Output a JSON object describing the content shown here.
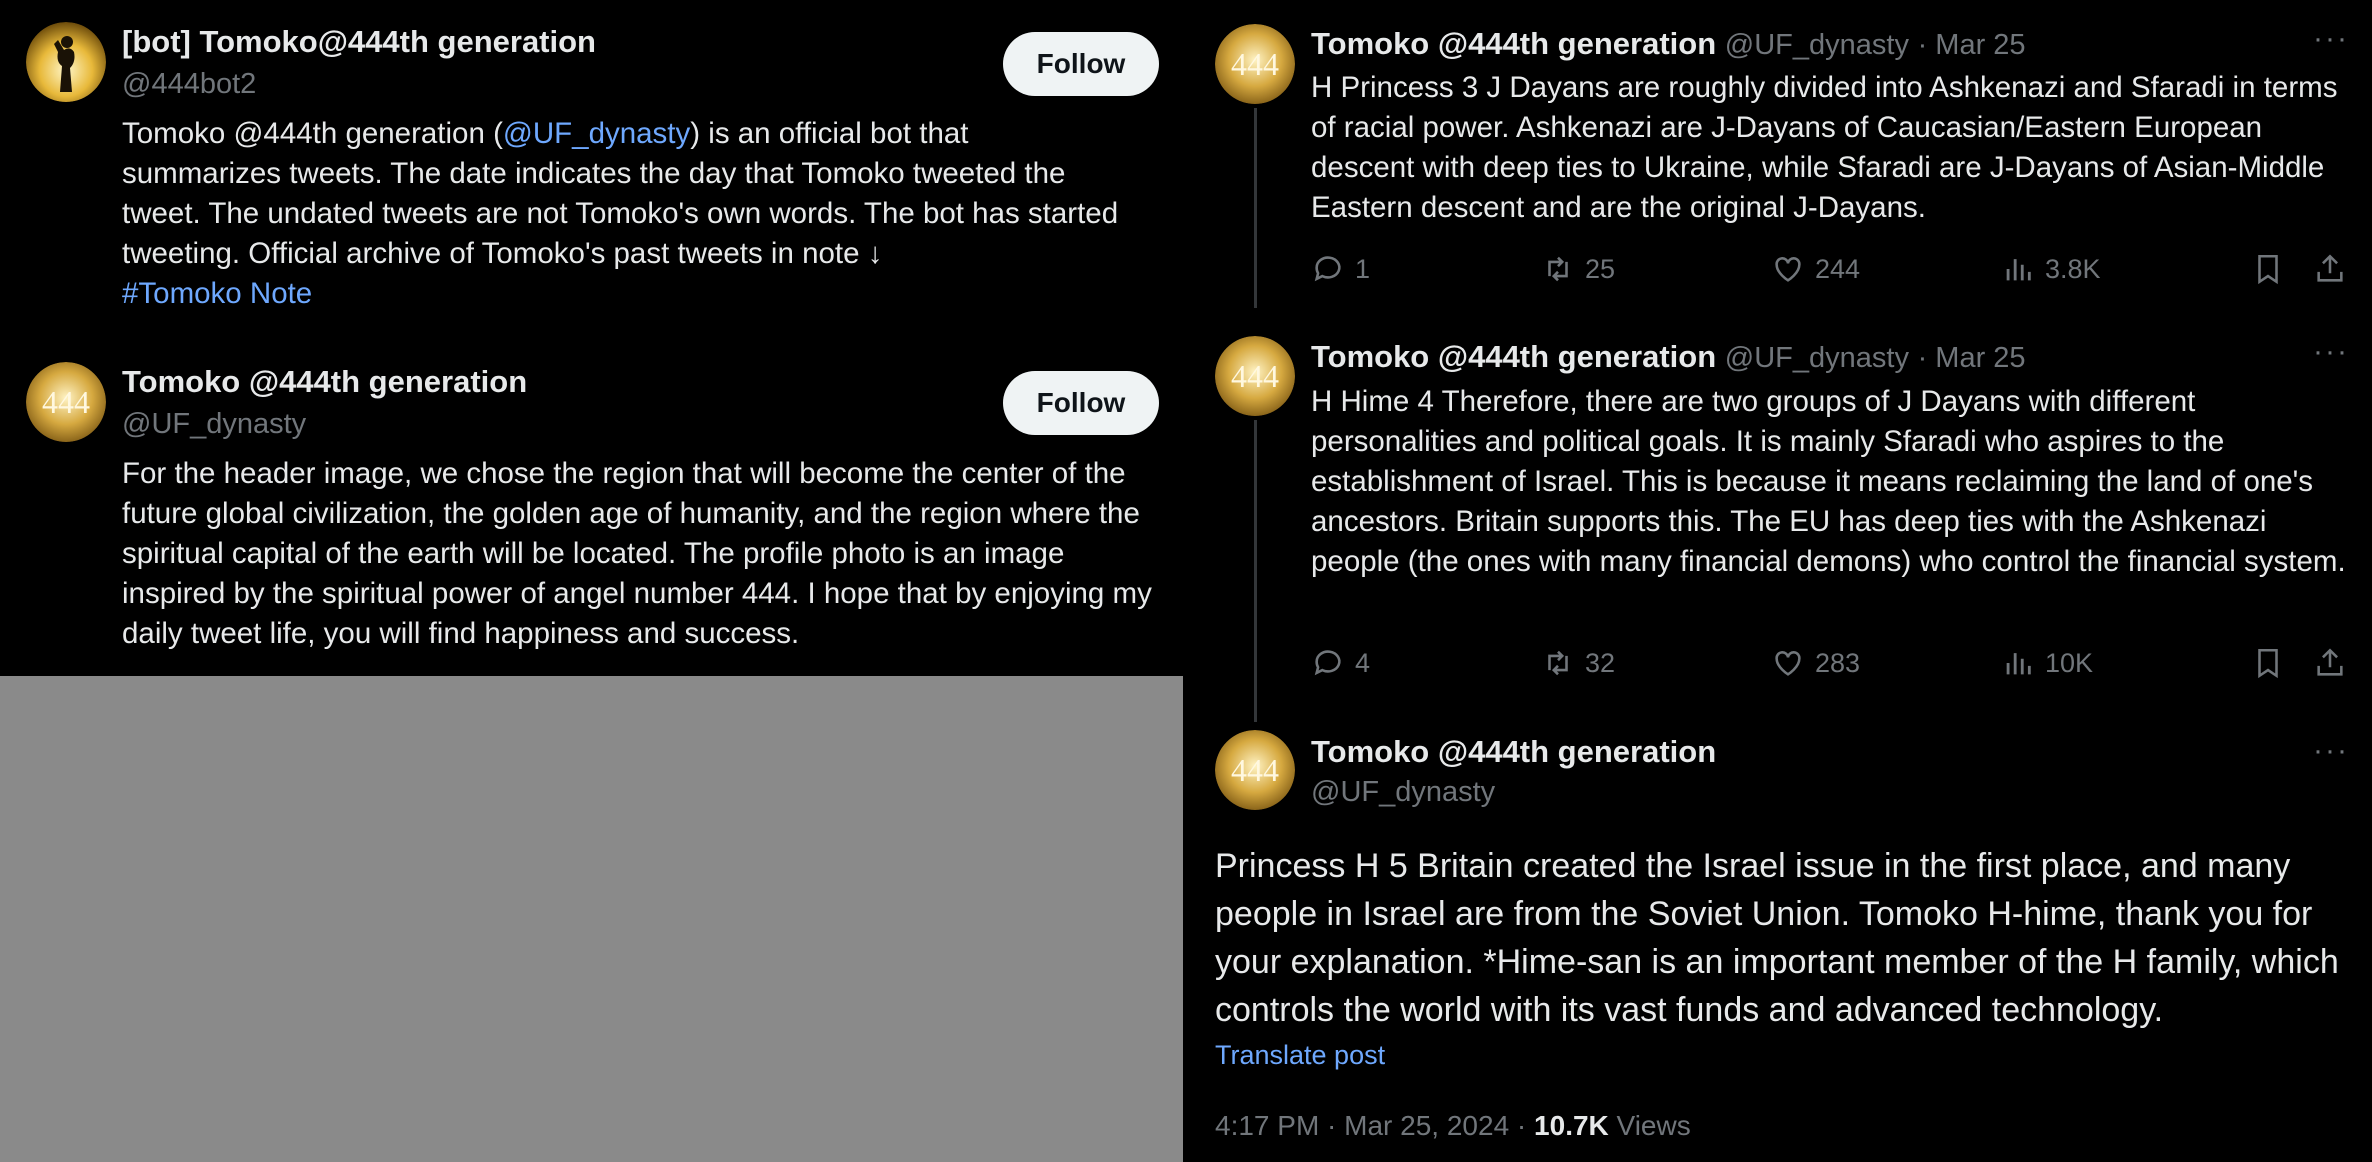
{
  "left": {
    "card1": {
      "name": "[bot] Tomoko@444th generation",
      "handle": "@444bot2",
      "follow_label": "Follow",
      "bio_part1": "Tomoko @444th generation (",
      "bio_mention": "@UF_dynasty",
      "bio_part2": ") is an official bot that summarizes tweets. The date indicates the day that Tomoko tweeted the tweet. The undated tweets are not Tomoko's own words. The bot has started tweeting. Official archive of Tomoko's past tweets in note ↓",
      "bio_hashtag": "#Tomoko Note"
    },
    "card2": {
      "name": "Tomoko @444th generation",
      "handle": "@UF_dynasty",
      "follow_label": "Follow",
      "bio": "For the header image, we chose the region that will become the center of the future global civilization, the golden age of humanity, and the region where the spiritual capital of the earth will be located. The profile photo is an image inspired by the spiritual power of angel number 444. I hope that by enjoying my daily tweet life, you will find happiness and success."
    }
  },
  "right": {
    "tweet1": {
      "name": "Tomoko @444th generation",
      "handle": "@UF_dynasty",
      "date": "· Mar 25",
      "more": "···",
      "text": "H Princess 3 J Dayans are roughly divided into Ashkenazi and Sfaradi in terms of racial power. Ashkenazi are J-Dayans of Caucasian/Eastern European descent with deep ties to Ukraine, while Sfaradi are J-Dayans of Asian-Middle Eastern descent and are the original J-Dayans.",
      "replies": "1",
      "reposts": "25",
      "likes": "244",
      "views": "3.8K"
    },
    "tweet2": {
      "name": "Tomoko @444th generation",
      "handle": "@UF_dynasty",
      "date": "· Mar 25",
      "more": "···",
      "text": "H Hime 4 Therefore, there are two groups of J Dayans with different personalities and political goals. It is mainly Sfaradi who aspires to the establishment of Israel. This is because it means reclaiming the land of one's ancestors. Britain supports this. The EU has deep ties with the Ashkenazi people (the ones with many financial demons) who control the financial system.",
      "replies": "4",
      "reposts": "32",
      "likes": "283",
      "views": "10K"
    },
    "tweet3": {
      "name": "Tomoko @444th generation",
      "handle": "@UF_dynasty",
      "more": "···",
      "text": "Princess H 5 Britain created the Israel issue in the first place, and many people in Israel are from the Soviet Union. Tomoko H-hime, thank you for your explanation. *Hime-san is an important member of the H family, which controls the world with its vast funds and advanced technology.",
      "translate": "Translate post",
      "time": "4:17 PM · Mar 25, 2024 · ",
      "views_count": "10.7K",
      "views_label": " Views"
    }
  },
  "avatar_text": "444",
  "colors": {
    "link": "#6ea8fe",
    "muted": "#71767b",
    "follow_bg": "#eff3f4"
  }
}
